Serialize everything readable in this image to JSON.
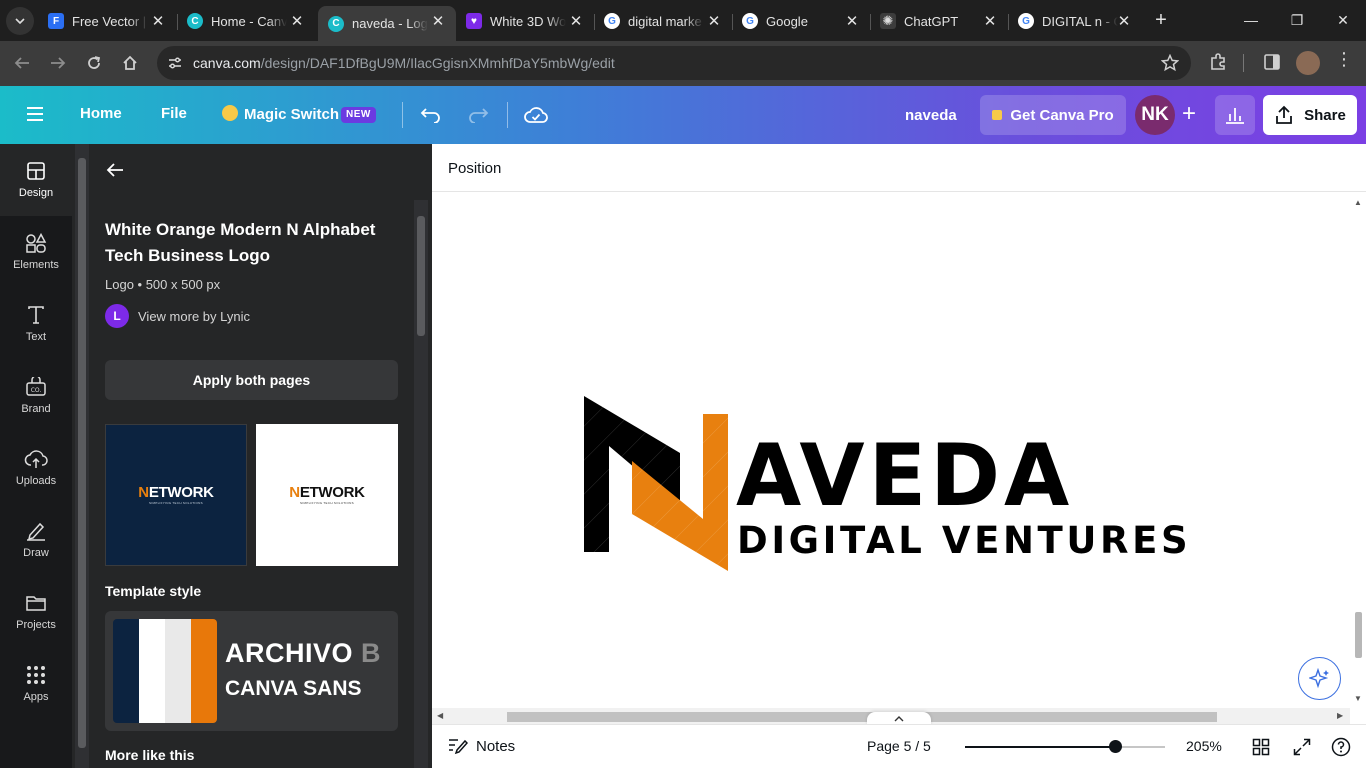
{
  "browser": {
    "tabs": [
      {
        "title": "Free Vector |",
        "fav_color": "#2b6ff3",
        "fav_letter": "F"
      },
      {
        "title": "Home - Canva",
        "fav_color": "#1bbcc9",
        "fav_letter": "C"
      },
      {
        "title": "naveda - Logo",
        "fav_color": "#1bbcc9",
        "fav_letter": "C"
      },
      {
        "title": "White 3D Wo",
        "fav_color": "#7d2ae8",
        "fav_letter": "♥"
      },
      {
        "title": "digital marke",
        "fav_color": "#ffffff",
        "fav_letter": "G"
      },
      {
        "title": "Google",
        "fav_color": "#ffffff",
        "fav_letter": "G"
      },
      {
        "title": "ChatGPT",
        "fav_color": "#3c3c3c",
        "fav_letter": "✺"
      },
      {
        "title": "DIGITAL n - G",
        "fav_color": "#ffffff",
        "fav_letter": "G"
      }
    ],
    "url_domain": "canva.com",
    "url_path": "/design/DAF1DfBgU9M/IlacGgisnXMmhfDaY5mbWg/edit"
  },
  "header": {
    "home": "Home",
    "file": "File",
    "magic_switch": "Magic Switch",
    "new_badge": "NEW",
    "doc_name": "naveda",
    "get_pro": "Get Canva Pro",
    "avatar_initials": "NK",
    "share": "Share"
  },
  "rail": {
    "items": [
      {
        "label": "Design",
        "icon": "design-icon"
      },
      {
        "label": "Elements",
        "icon": "elements-icon"
      },
      {
        "label": "Text",
        "icon": "text-icon"
      },
      {
        "label": "Brand",
        "icon": "brand-icon"
      },
      {
        "label": "Uploads",
        "icon": "uploads-icon"
      },
      {
        "label": "Draw",
        "icon": "draw-icon"
      },
      {
        "label": "Projects",
        "icon": "projects-icon"
      },
      {
        "label": "Apps",
        "icon": "apps-icon"
      }
    ]
  },
  "panel": {
    "title": "White Orange Modern N Alphabet Tech Business Logo",
    "meta": "Logo • 500 x 500 px",
    "author_initial": "L",
    "author_link": "View more by Lynic",
    "apply_button": "Apply both pages",
    "thumbnail_logo_text": "ETWORK",
    "thumbnail_logo_letter": "N",
    "thumbnail_sub": "SIMPLIFYING TECH SOLUTIONS",
    "template_style_title": "Template style",
    "style_colors": [
      "#0c2340",
      "#ffffff",
      "#e9e9e9",
      "#e8780a"
    ],
    "font_heading": "ARCHIVO B",
    "font_heading_visible": "ARCHIVO ",
    "font_heading_faded": "B",
    "font_body": "CANVA SANS",
    "more_like_this": "More like this"
  },
  "canvas": {
    "position_label": "Position",
    "logo_main": "AVEDA",
    "logo_tagline": "DIGITAL VENTURES",
    "logo_colors": {
      "black": "#000000",
      "orange": "#e8800f"
    }
  },
  "bottom": {
    "notes": "Notes",
    "page_indicator": "Page 5 / 5",
    "zoom_value": "205%",
    "zoom_fraction": 0.75
  }
}
